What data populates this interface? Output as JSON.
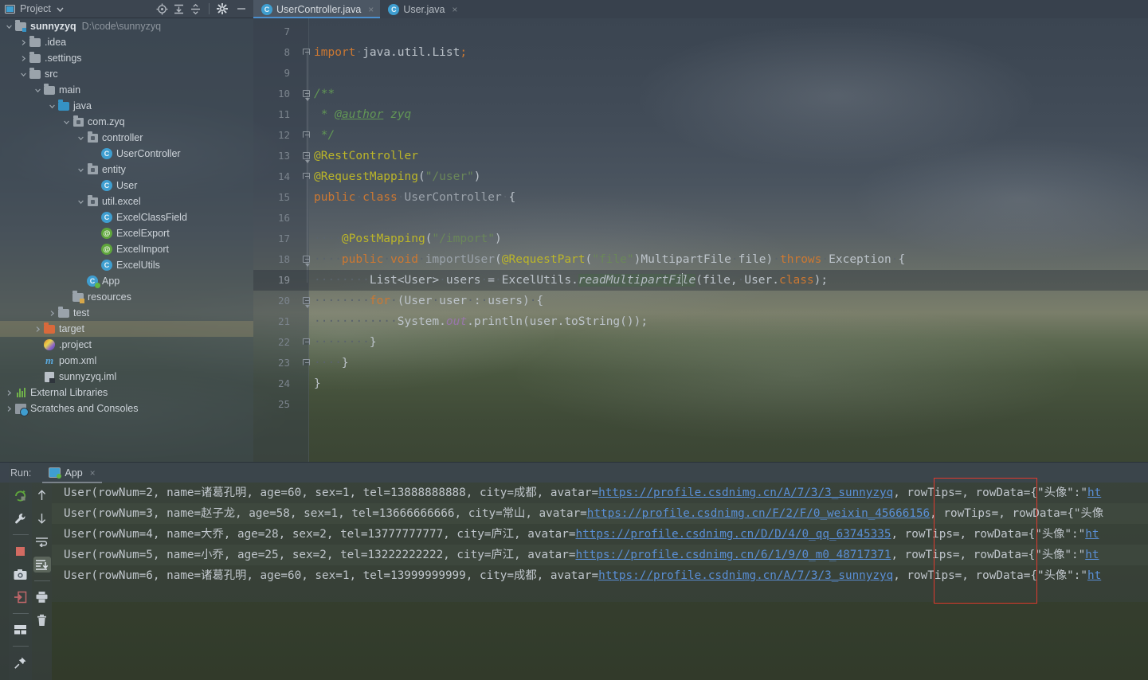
{
  "app": {
    "theme_accent": "#4b8fce",
    "annotation_box_color": "#e03a2f"
  },
  "project_panel": {
    "title": "Project",
    "dropdown_icon": "chevron-down-icon",
    "toolbar": [
      {
        "name": "locate-icon",
        "label": ""
      },
      {
        "name": "expand-all-icon",
        "label": ""
      },
      {
        "name": "collapse-all-icon",
        "label": ""
      },
      {
        "name": "gear-icon",
        "label": ""
      },
      {
        "name": "minimize-icon",
        "label": ""
      }
    ],
    "tree": [
      {
        "indent": 0,
        "arrow": "down",
        "icon": "module-folder",
        "label": "sunnyzyq",
        "bold": true,
        "path": "D:\\code\\sunnyzyq"
      },
      {
        "indent": 1,
        "arrow": "right",
        "icon": "folder-grey",
        "label": ".idea"
      },
      {
        "indent": 1,
        "arrow": "right",
        "icon": "folder-grey",
        "label": ".settings"
      },
      {
        "indent": 1,
        "arrow": "down",
        "icon": "folder-grey",
        "label": "src"
      },
      {
        "indent": 2,
        "arrow": "down",
        "icon": "folder-grey",
        "label": "main"
      },
      {
        "indent": 3,
        "arrow": "down",
        "icon": "folder-blue",
        "label": "java"
      },
      {
        "indent": 4,
        "arrow": "down",
        "icon": "package",
        "label": "com.zyq"
      },
      {
        "indent": 5,
        "arrow": "down",
        "icon": "package",
        "label": "controller"
      },
      {
        "indent": 6,
        "arrow": "none",
        "icon": "class",
        "label": "UserController"
      },
      {
        "indent": 5,
        "arrow": "down",
        "icon": "package",
        "label": "entity"
      },
      {
        "indent": 6,
        "arrow": "none",
        "icon": "class",
        "label": "User"
      },
      {
        "indent": 5,
        "arrow": "down",
        "icon": "package",
        "label": "util.excel"
      },
      {
        "indent": 6,
        "arrow": "none",
        "icon": "class",
        "label": "ExcelClassField"
      },
      {
        "indent": 6,
        "arrow": "none",
        "icon": "annotation",
        "label": "ExcelExport"
      },
      {
        "indent": 6,
        "arrow": "none",
        "icon": "annotation",
        "label": "ExcelImport"
      },
      {
        "indent": 6,
        "arrow": "none",
        "icon": "class",
        "label": "ExcelUtils"
      },
      {
        "indent": 5,
        "arrow": "none",
        "icon": "runnable-class",
        "label": "App"
      },
      {
        "indent": 4,
        "arrow": "none",
        "icon": "folder-resources",
        "label": "resources"
      },
      {
        "indent": 3,
        "arrow": "right",
        "icon": "folder-grey",
        "label": "test"
      },
      {
        "indent": 2,
        "arrow": "right",
        "icon": "folder-orange",
        "label": "target",
        "selected": true
      },
      {
        "indent": 2,
        "arrow": "none",
        "icon": "project-file",
        "label": ".project"
      },
      {
        "indent": 2,
        "arrow": "none",
        "icon": "maven",
        "label": "pom.xml"
      },
      {
        "indent": 2,
        "arrow": "none",
        "icon": "iml",
        "label": "sunnyzyq.iml"
      },
      {
        "indent": 0,
        "arrow": "right",
        "icon": "libraries",
        "label": "External Libraries"
      },
      {
        "indent": 0,
        "arrow": "right",
        "icon": "scratches",
        "label": "Scratches and Consoles"
      }
    ]
  },
  "editor": {
    "tabs": [
      {
        "label": "UserController.java",
        "icon": "class-icon",
        "active": true,
        "close": "×"
      },
      {
        "label": "User.java",
        "icon": "class-icon",
        "active": false,
        "close": "×"
      }
    ],
    "current_line": 19,
    "first_line": 7,
    "lines": [
      {
        "n": 7,
        "text": ""
      },
      {
        "n": 8,
        "text": "import java.util.List;"
      },
      {
        "n": 9,
        "text": ""
      },
      {
        "n": 10,
        "text": "/**"
      },
      {
        "n": 11,
        "text": " * @author zyq"
      },
      {
        "n": 12,
        "text": " */"
      },
      {
        "n": 13,
        "text": "@RestController"
      },
      {
        "n": 14,
        "text": "@RequestMapping(\"/user\")"
      },
      {
        "n": 15,
        "text": "public class UserController {"
      },
      {
        "n": 16,
        "text": ""
      },
      {
        "n": 17,
        "text": "    @PostMapping(\"/import\")"
      },
      {
        "n": 18,
        "text": "    public void importUser(@RequestPart(\"file\")MultipartFile file) throws Exception {"
      },
      {
        "n": 19,
        "text": "        List<User> users = ExcelUtils.readMultipartFile(file, User.class);"
      },
      {
        "n": 20,
        "text": "        for (User user : users) {"
      },
      {
        "n": 21,
        "text": "            System.out.println(user.toString());"
      },
      {
        "n": 22,
        "text": "        }"
      },
      {
        "n": 23,
        "text": "    }"
      },
      {
        "n": 24,
        "text": "}"
      },
      {
        "n": 25,
        "text": ""
      }
    ]
  },
  "run_panel": {
    "label": "Run:",
    "tab_label": "App",
    "tab_close": "×",
    "toolbar_left": [
      {
        "name": "rerun-icon"
      },
      {
        "name": "wrench-icon"
      },
      {
        "name": "stop-icon"
      },
      {
        "name": "camera-icon"
      },
      {
        "name": "export-icon"
      },
      {
        "name": "layout-icon"
      },
      {
        "name": "pin-icon"
      }
    ],
    "toolbar_right": [
      {
        "name": "arrow-up-icon"
      },
      {
        "name": "arrow-down-icon"
      },
      {
        "name": "soft-wrap-icon"
      },
      {
        "name": "scroll-to-end-icon",
        "active": true
      },
      {
        "name": "print-icon"
      },
      {
        "name": "trash-icon"
      }
    ],
    "console_lines": [
      {
        "prefix": "User(rowNum=2, name=诸葛孔明, age=60, sex=1, tel=13888888888, city=成都, avatar=",
        "link": "https://profile.csdnimg.cn/A/7/3/3_sunnyzyq",
        "suffix": ", rowTips=, rowData={\"头像\":\"",
        "tail_link": "ht"
      },
      {
        "prefix": "User(rowNum=3, name=赵子龙, age=58, sex=1, tel=13666666666, city=常山, avatar=",
        "link": "https://profile.csdnimg.cn/F/2/F/0_weixin_45666156",
        "suffix": ", rowTips=, rowData={\"头像",
        "tail_link": ""
      },
      {
        "prefix": "User(rowNum=4, name=大乔, age=28, sex=2, tel=13777777777, city=庐江, avatar=",
        "link": "https://profile.csdnimg.cn/D/D/4/0_qq_63745335",
        "suffix": ", rowTips=, rowData={\"头像\":\"",
        "tail_link": "ht"
      },
      {
        "prefix": "User(rowNum=5, name=小乔, age=25, sex=2, tel=13222222222, city=庐江, avatar=",
        "link": "https://profile.csdnimg.cn/6/1/9/0_m0_48717371",
        "suffix": ", rowTips=, rowData={\"头像\":\"",
        "tail_link": "ht"
      },
      {
        "prefix": "User(rowNum=6, name=诸葛孔明, age=60, sex=1, tel=13999999999, city=成都, avatar=",
        "link": "https://profile.csdnimg.cn/A/7/3/3_sunnyzyq",
        "suffix": ", rowTips=, rowData={\"头像\":\"",
        "tail_link": "ht"
      }
    ]
  }
}
